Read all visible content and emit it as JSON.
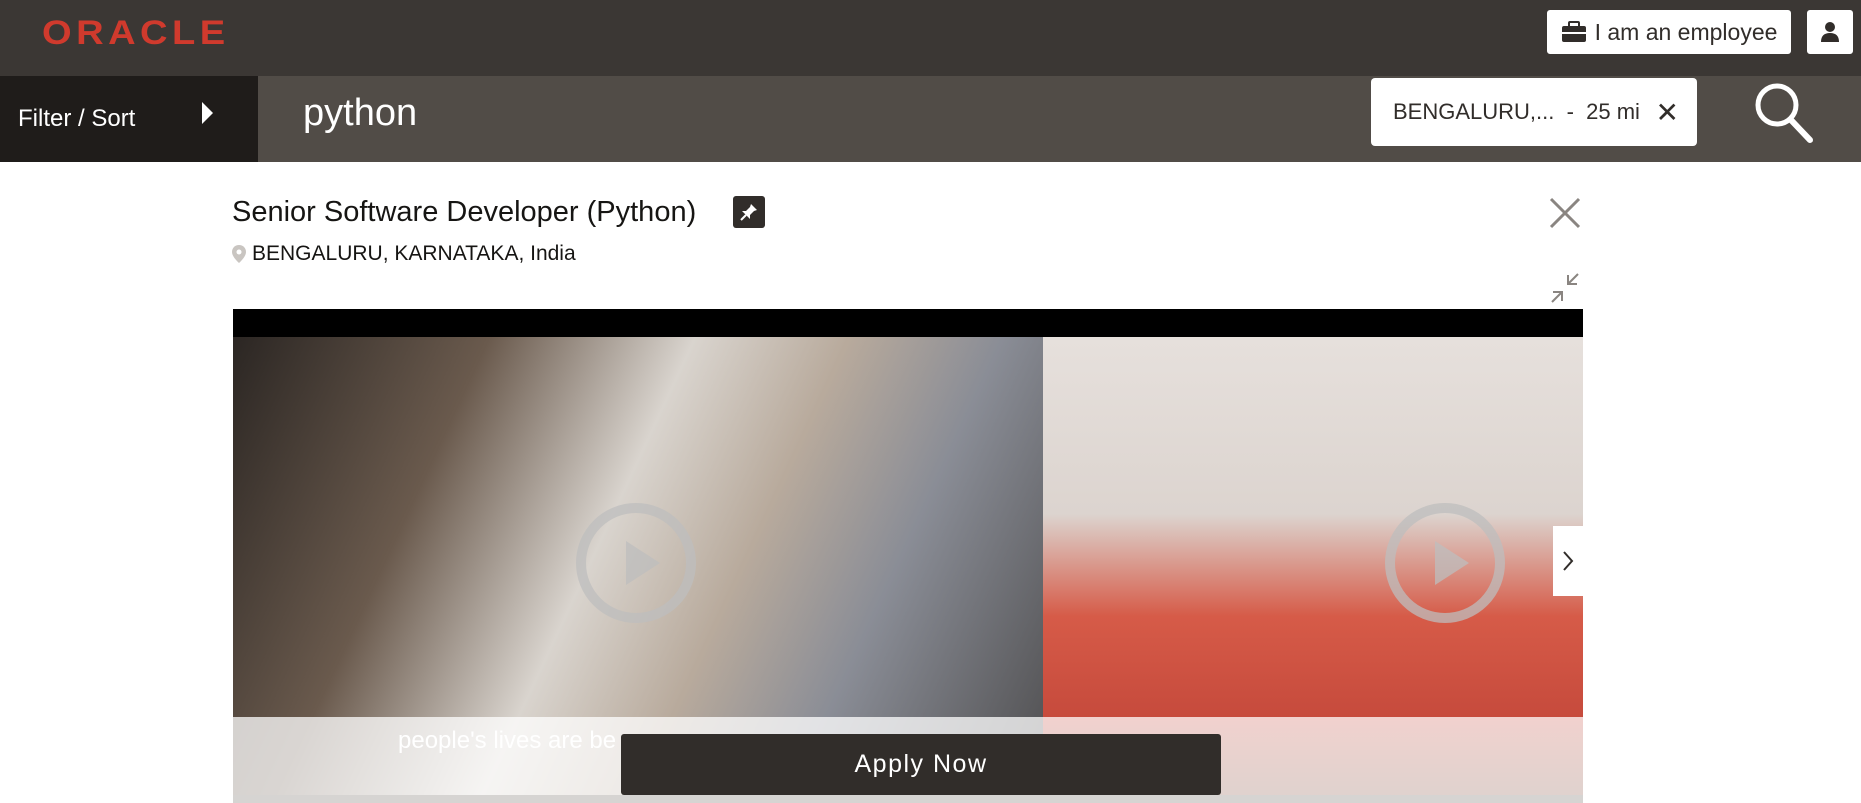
{
  "header": {
    "logo_text": "ORACLE",
    "employee_button_label": "I am an employee",
    "icons": {
      "briefcase": "briefcase-icon",
      "user": "user-icon"
    }
  },
  "search": {
    "filter_label": "Filter / Sort",
    "query": "python",
    "location_pill": "BENGALURU,...  -  25 mi",
    "clear_glyph": "✕"
  },
  "job": {
    "title": "Senior Software Developer (Python)",
    "location": "BENGALURU, KARNATAKA, India"
  },
  "media": {
    "caption": "people's lives are be",
    "apply_label": "Apply Now"
  },
  "colors": {
    "brand_red": "#d03a2d",
    "header_bg": "#3b3734",
    "search_bg": "#514c47",
    "filter_bg": "#1f1c1a",
    "apply_bg": "#312d2a"
  }
}
